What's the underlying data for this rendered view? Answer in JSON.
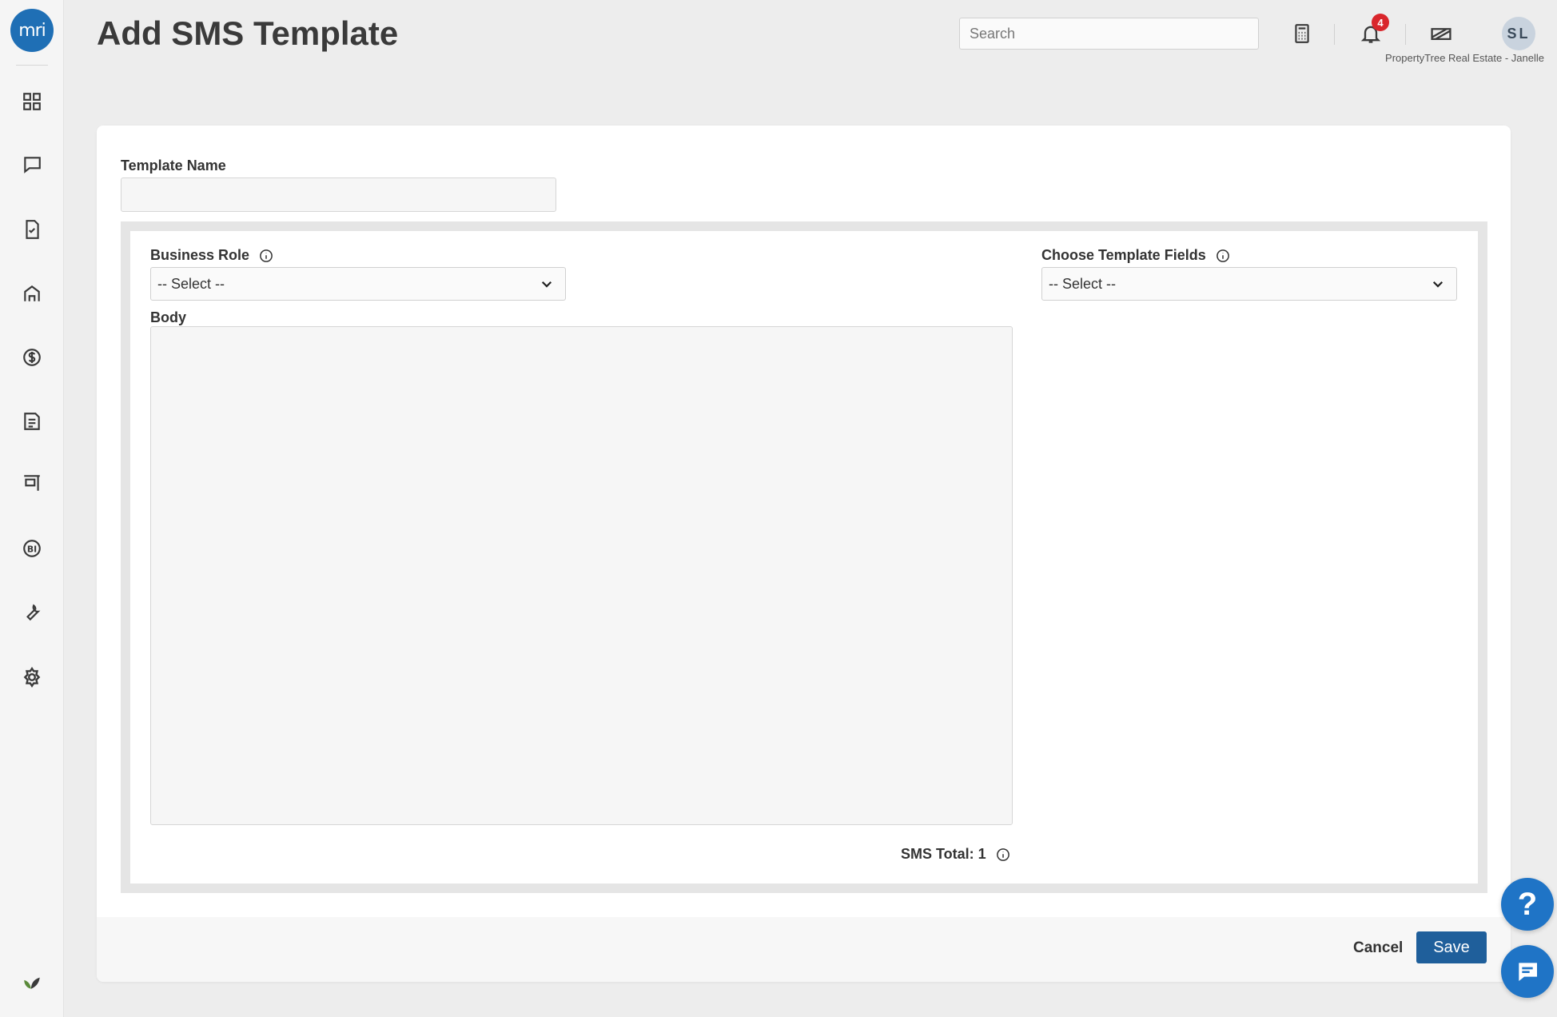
{
  "app": {
    "logo_text": "mri",
    "page_title": "Add SMS Template"
  },
  "header": {
    "search_placeholder": "Search",
    "notification_count": "4",
    "avatar_initials": "SL",
    "account_label": "PropertyTree Real Estate - Janelle"
  },
  "sidebar": {
    "items": [
      {
        "icon": "dashboard-grid-icon"
      },
      {
        "icon": "chat-bubble-icon"
      },
      {
        "icon": "task-document-icon"
      },
      {
        "icon": "property-house-icon"
      },
      {
        "icon": "dollar-icon"
      },
      {
        "icon": "report-document-icon"
      },
      {
        "icon": "listing-sign-icon"
      },
      {
        "icon": "bi-icon"
      },
      {
        "icon": "wrench-icon"
      },
      {
        "icon": "gear-icon"
      },
      {
        "icon": "leaf-icon"
      }
    ]
  },
  "form": {
    "template_name_label": "Template Name",
    "template_name_value": "",
    "business_role_label": "Business Role",
    "business_role_value": "-- Select --",
    "template_fields_label": "Choose Template Fields",
    "template_fields_value": "-- Select --",
    "body_label": "Body",
    "body_value": "",
    "sms_total_label": "SMS Total: 1"
  },
  "footer": {
    "cancel_label": "Cancel",
    "save_label": "Save"
  },
  "floating": {
    "help_label": "?"
  },
  "colors": {
    "brand_blue": "#1f6fb5",
    "save_button": "#1f5f9b",
    "badge_red": "#d9262c",
    "fab_blue": "#1f74c6"
  }
}
